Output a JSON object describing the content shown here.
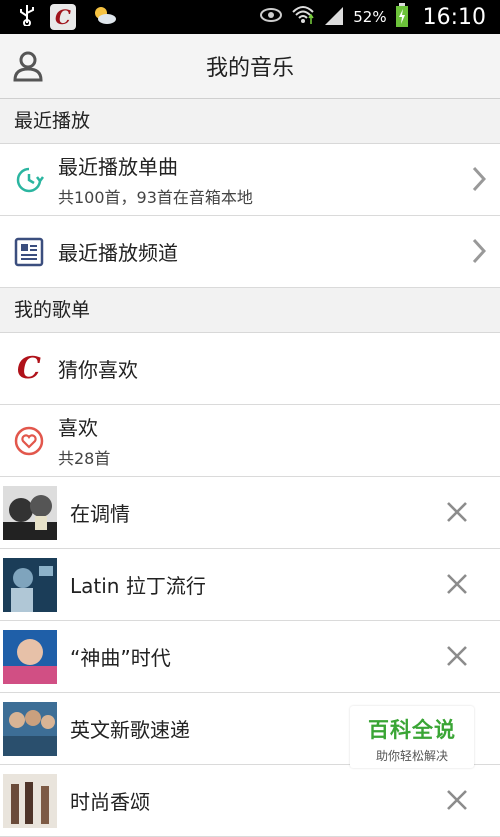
{
  "status_bar": {
    "battery": "52%",
    "time": "16:10",
    "app_icon_letter": "C"
  },
  "header": {
    "title": "我的音乐"
  },
  "recent_section": {
    "label": "最近播放"
  },
  "recent": [
    {
      "title": "最近播放单曲",
      "subtitle": "共100首，93首在音箱本地",
      "icon": "clock-icon"
    },
    {
      "title": "最近播放频道",
      "icon": "channel-list-icon"
    }
  ],
  "playlist_section": {
    "label": "我的歌单"
  },
  "guess": {
    "title": "猜你喜欢",
    "icon_letter": "C"
  },
  "like": {
    "title": "喜欢",
    "subtitle": "共28首",
    "icon": "heart-icon"
  },
  "playlists": [
    {
      "title": "在调情"
    },
    {
      "title": "Latin 拉丁流行"
    },
    {
      "title": "“神曲”时代"
    },
    {
      "title": "英文新歌速递"
    },
    {
      "title": "时尚香颂"
    }
  ],
  "watermark": {
    "title": "百科全说",
    "subtitle": "助你轻松解决"
  },
  "colors": {
    "accent_green": "#2bb5a0",
    "accent_red": "#e2574c",
    "brand_red": "#b0121a"
  }
}
